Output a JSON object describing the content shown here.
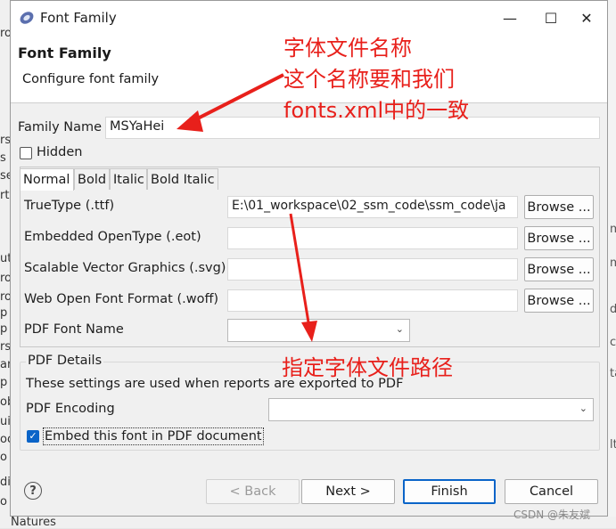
{
  "background": {
    "left_fragments": [
      "ro",
      "rs",
      "s",
      "se",
      "rt",
      "ut",
      "ro",
      "ro",
      "p",
      "p",
      "rs",
      "ar",
      "p",
      "ob",
      "ui",
      "oo",
      "o",
      "di",
      "o"
    ],
    "right_fragments": [
      "m",
      "m",
      "d",
      "ca",
      "ta",
      "lt"
    ],
    "bottom_fragment": "Natures"
  },
  "window": {
    "title": "Font Family",
    "minimize_glyph": "—",
    "maximize_glyph": "☐",
    "close_glyph": "✕"
  },
  "header": {
    "title": "Font Family",
    "subtitle": "Configure font family"
  },
  "form": {
    "family_name_label": "Family Name",
    "family_name_value": "MSYaHei",
    "hidden_label": "Hidden",
    "hidden_checked": false
  },
  "tabs": [
    "Normal",
    "Bold",
    "Italic",
    "Bold Italic"
  ],
  "active_tab": "Normal",
  "font_files": {
    "truetype_label": "TrueType (.ttf)",
    "truetype_value": "E:\\01_workspace\\02_ssm_code\\ssm_code\\ja",
    "eot_label": "Embedded OpenType (.eot)",
    "eot_value": "",
    "svg_label": "Scalable Vector Graphics (.svg)",
    "svg_value": "",
    "woff_label": "Web Open Font Format (.woff)",
    "woff_value": "",
    "browse_label": "Browse ...",
    "pdf_font_name_label": "PDF Font Name",
    "pdf_font_name_value": ""
  },
  "pdf_details": {
    "group_title": "PDF Details",
    "description": "These settings are used when reports are exported to PDF",
    "encoding_label": "PDF Encoding",
    "encoding_value": "",
    "embed_label": "Embed this font in PDF document",
    "embed_checked": true
  },
  "footer": {
    "help_glyph": "?",
    "back_label": "< Back",
    "next_label": "Next >",
    "finish_label": "Finish",
    "cancel_label": "Cancel"
  },
  "annotations": {
    "note1_line1": "字体文件名称",
    "note1_line2": "这个名称要和我们",
    "note1_line3": "fonts.xml中的一致",
    "note2": "指定字体文件路径",
    "color": "#e8201b"
  },
  "watermark": "CSDN @朱友斌",
  "colors": {
    "accent": "#0a64c8",
    "dialog_bg": "#f0f0f0",
    "annotation": "#e8201b"
  }
}
